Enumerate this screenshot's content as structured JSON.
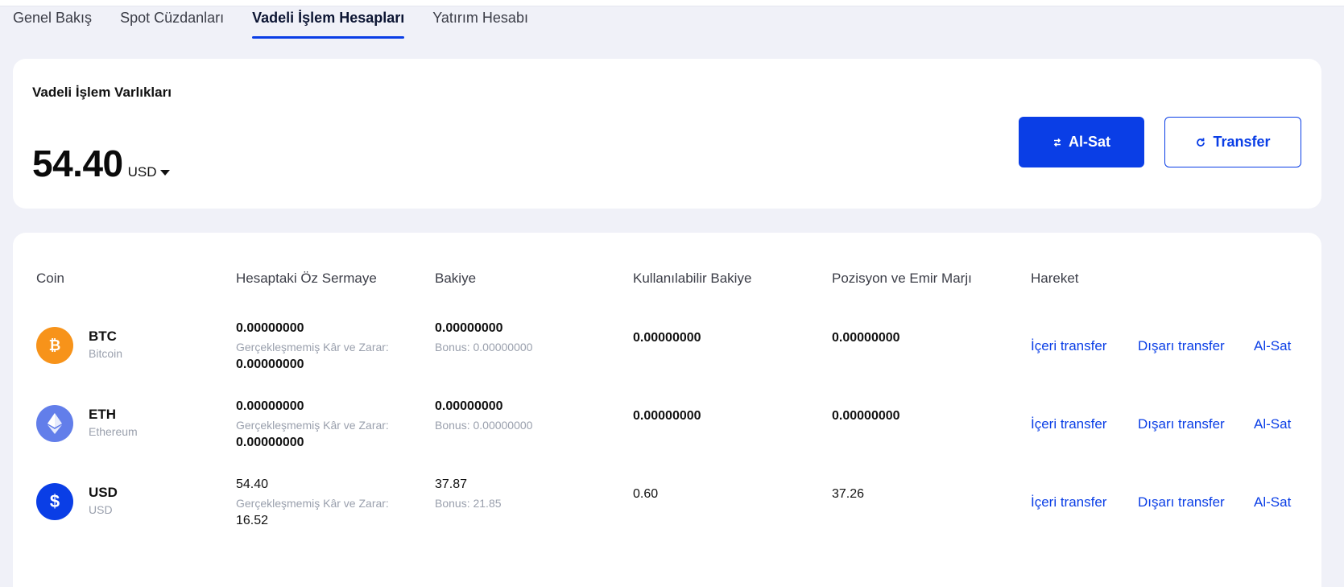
{
  "tabs": [
    {
      "label": "Genel Bakış",
      "active": false
    },
    {
      "label": "Spot Cüzdanları",
      "active": false
    },
    {
      "label": "Vadeli İşlem Hesapları",
      "active": true
    },
    {
      "label": "Yatırım Hesabı",
      "active": false
    }
  ],
  "summary": {
    "title": "Vadeli İşlem Varlıkları",
    "amount": "54.40",
    "currency": "USD",
    "buy_sell_label": "Al-Sat",
    "transfer_label": "Transfer"
  },
  "table": {
    "headers": [
      "Coin",
      "Hesaptaki Öz Sermaye",
      "Bakiye",
      "Kullanılabilir Bakiye",
      "Pozisyon ve Emir Marjı",
      "Hareket"
    ],
    "rows": [
      {
        "symbol": "BTC",
        "name": "Bitcoin",
        "icon": "bitcoin-icon",
        "color": "#f7931a",
        "equity": "0.00000000",
        "pnl_label": "Gerçekleşmemiş Kâr ve Zarar:",
        "pnl": "0.00000000",
        "balance": "0.00000000",
        "bonus": "Bonus: 0.00000000",
        "available": "0.00000000",
        "margin": "0.00000000",
        "action_in": "İçeri transfer",
        "action_out": "Dışarı transfer",
        "action_trade": "Al-Sat"
      },
      {
        "symbol": "ETH",
        "name": "Ethereum",
        "icon": "ethereum-icon",
        "color": "#627eea",
        "equity": "0.00000000",
        "pnl_label": "Gerçekleşmemiş Kâr ve Zarar:",
        "pnl": "0.00000000",
        "balance": "0.00000000",
        "bonus": "Bonus: 0.00000000",
        "available": "0.00000000",
        "margin": "0.00000000",
        "action_in": "İçeri transfer",
        "action_out": "Dışarı transfer",
        "action_trade": "Al-Sat"
      },
      {
        "symbol": "USD",
        "name": "USD",
        "icon": "dollar-icon",
        "color": "#0a3ee6",
        "equity": "54.40",
        "pnl_label": "Gerçekleşmemiş Kâr ve Zarar:",
        "pnl": "16.52",
        "balance": "37.87",
        "bonus": "Bonus: 21.85",
        "available": "0.60",
        "margin": "37.26",
        "action_in": "İçeri transfer",
        "action_out": "Dışarı transfer",
        "action_trade": "Al-Sat"
      }
    ]
  }
}
